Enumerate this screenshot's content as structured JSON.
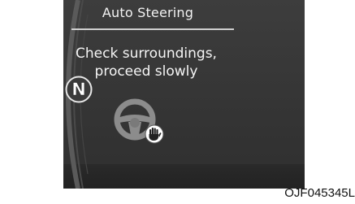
{
  "display": {
    "title": "Auto Steering",
    "message": {
      "line1": "Check surroundings,",
      "line2": "proceed slowly"
    },
    "gear_indicator": "N",
    "steering_icon": "steering-wheel-hand-icon"
  },
  "caption": "OJF045345L",
  "colors": {
    "panel_background": "#383838",
    "text": "#f2f2f2",
    "icon_gray": "#8a8a8a"
  }
}
